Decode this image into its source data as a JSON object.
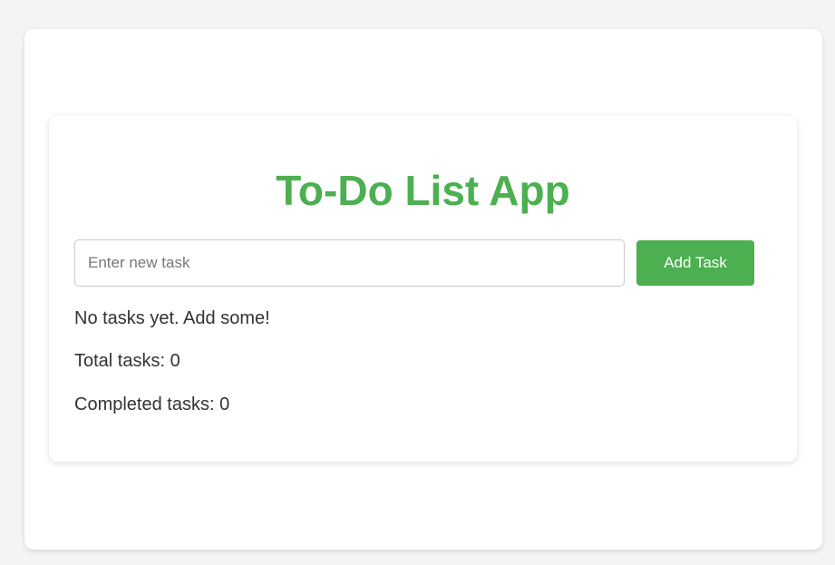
{
  "app": {
    "title": "To-Do List App"
  },
  "task_input": {
    "value": "",
    "placeholder": "Enter new task"
  },
  "add_button": {
    "label": "Add Task"
  },
  "list": {
    "empty_message": "No tasks yet. Add some!"
  },
  "stats": {
    "total_label": "Total tasks: 0",
    "completed_label": "Completed tasks: 0"
  },
  "colors": {
    "accent": "#4caf50",
    "background": "#f4f4f4",
    "card": "#ffffff",
    "text": "#333333"
  }
}
